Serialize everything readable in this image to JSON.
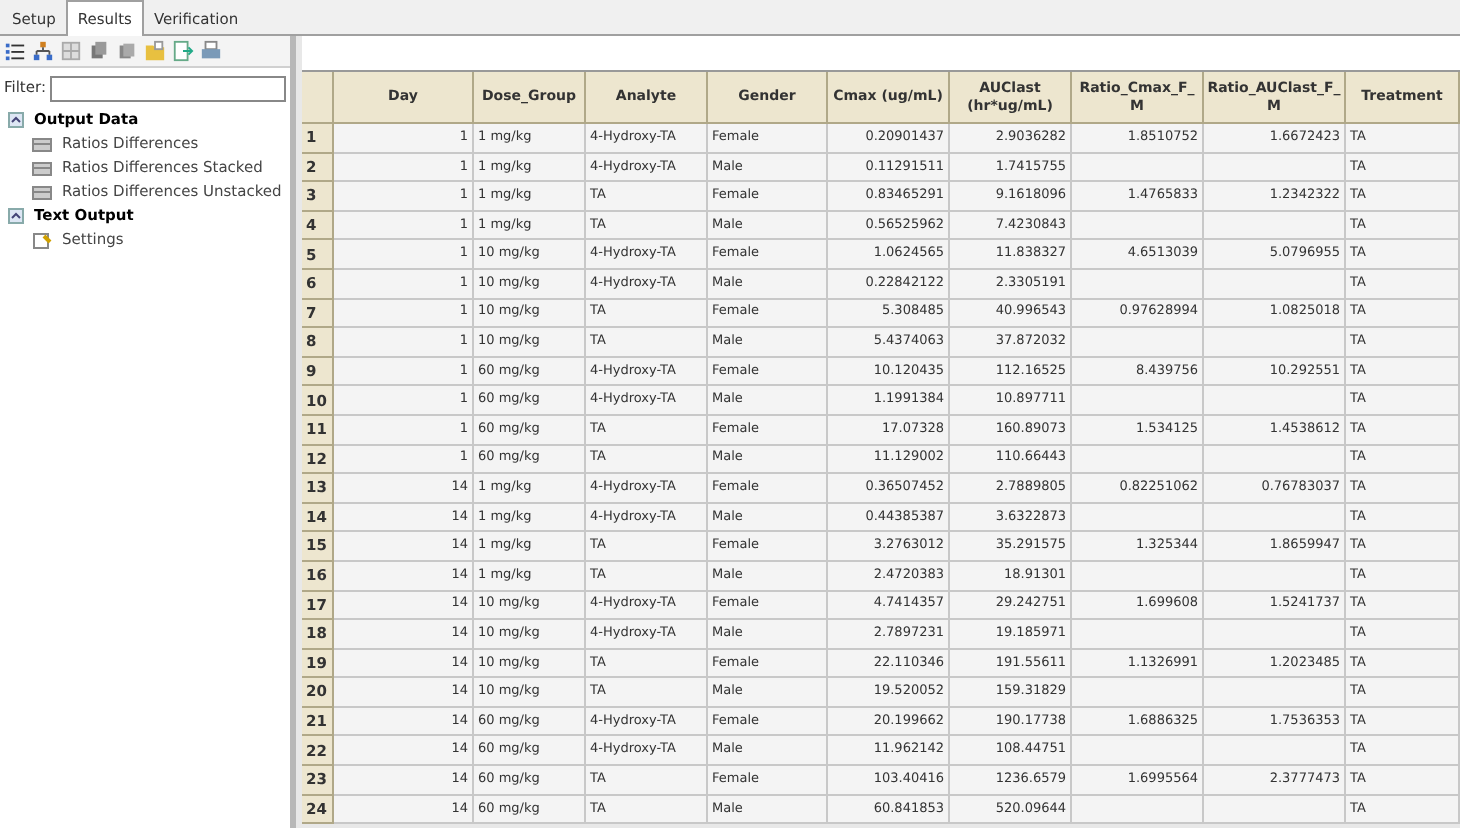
{
  "tabs": [
    {
      "label": "Setup",
      "selected": false
    },
    {
      "label": "Results",
      "selected": true
    },
    {
      "label": "Verification",
      "selected": false
    }
  ],
  "filter": {
    "label": "Filter:"
  },
  "tree": [
    {
      "label": "Output Data",
      "expanded": true,
      "kind": "folder",
      "children": [
        {
          "label": "Ratios Differences",
          "kind": "table",
          "selected": false
        },
        {
          "label": "Ratios Differences Stacked",
          "kind": "table",
          "selected": false
        },
        {
          "label": "Ratios Differences Unstacked",
          "kind": "table",
          "selected": false
        }
      ]
    },
    {
      "label": "Text Output",
      "expanded": true,
      "kind": "folder",
      "children": [
        {
          "label": "Settings",
          "kind": "text",
          "selected": false
        }
      ]
    }
  ],
  "table": {
    "columns": [
      "Day",
      "Dose_Group",
      "Analyte",
      "Gender",
      "Cmax (ug/mL)",
      "AUClast (hr*ug/mL)",
      "Ratio_Cmax_F_M",
      "Ratio_AUClast_F_M",
      "Treatment"
    ],
    "rows": [
      {
        "n": "1",
        "day": "1",
        "dose_group": "1 mg/kg",
        "analyte": "4-Hydroxy-TA",
        "gender": "Female",
        "cmax": "0.20901437",
        "auclast": "2.9036282",
        "ratio_cmax": "1.8510752",
        "ratio_auclast": "1.6672423",
        "treatment": "TA"
      },
      {
        "n": "2",
        "day": "1",
        "dose_group": "1 mg/kg",
        "analyte": "4-Hydroxy-TA",
        "gender": "Male",
        "cmax": "0.11291511",
        "auclast": "1.7415755",
        "treatment": "TA"
      },
      {
        "n": "3",
        "day": "1",
        "dose_group": "1 mg/kg",
        "analyte": "TA",
        "gender": "Female",
        "cmax": "0.83465291",
        "auclast": "9.1618096",
        "ratio_cmax": "1.4765833",
        "ratio_auclast": "1.2342322",
        "treatment": "TA"
      },
      {
        "n": "4",
        "day": "1",
        "dose_group": "1 mg/kg",
        "analyte": "TA",
        "gender": "Male",
        "cmax": "0.56525962",
        "auclast": "7.4230843",
        "treatment": "TA"
      },
      {
        "n": "5",
        "day": "1",
        "dose_group": "10 mg/kg",
        "analyte": "4-Hydroxy-TA",
        "gender": "Female",
        "cmax": "1.0624565",
        "auclast": "11.838327",
        "ratio_cmax": "4.6513039",
        "ratio_auclast": "5.0796955",
        "treatment": "TA"
      },
      {
        "n": "6",
        "day": "1",
        "dose_group": "10 mg/kg",
        "analyte": "4-Hydroxy-TA",
        "gender": "Male",
        "cmax": "0.22842122",
        "auclast": "2.3305191",
        "treatment": "TA"
      },
      {
        "n": "7",
        "day": "1",
        "dose_group": "10 mg/kg",
        "analyte": "TA",
        "gender": "Female",
        "cmax": "5.308485",
        "auclast": "40.996543",
        "ratio_cmax": "0.97628994",
        "ratio_auclast": "1.0825018",
        "treatment": "TA"
      },
      {
        "n": "8",
        "day": "1",
        "dose_group": "10 mg/kg",
        "analyte": "TA",
        "gender": "Male",
        "cmax": "5.4374063",
        "auclast": "37.872032",
        "treatment": "TA"
      },
      {
        "n": "9",
        "day": "1",
        "dose_group": "60 mg/kg",
        "analyte": "4-Hydroxy-TA",
        "gender": "Female",
        "cmax": "10.120435",
        "auclast": "112.16525",
        "ratio_cmax": "8.439756",
        "ratio_auclast": "10.292551",
        "treatment": "TA"
      },
      {
        "n": "10",
        "day": "1",
        "dose_group": "60 mg/kg",
        "analyte": "4-Hydroxy-TA",
        "gender": "Male",
        "cmax": "1.1991384",
        "auclast": "10.897711",
        "treatment": "TA"
      },
      {
        "n": "11",
        "day": "1",
        "dose_group": "60 mg/kg",
        "analyte": "TA",
        "gender": "Female",
        "cmax": "17.07328",
        "auclast": "160.89073",
        "ratio_cmax": "1.534125",
        "ratio_auclast": "1.4538612",
        "treatment": "TA"
      },
      {
        "n": "12",
        "day": "1",
        "dose_group": "60 mg/kg",
        "analyte": "TA",
        "gender": "Male",
        "cmax": "11.129002",
        "auclast": "110.66443",
        "treatment": "TA"
      },
      {
        "n": "13",
        "day": "14",
        "dose_group": "1 mg/kg",
        "analyte": "4-Hydroxy-TA",
        "gender": "Female",
        "cmax": "0.36507452",
        "auclast": "2.7889805",
        "ratio_cmax": "0.82251062",
        "ratio_auclast": "0.76783037",
        "treatment": "TA"
      },
      {
        "n": "14",
        "day": "14",
        "dose_group": "1 mg/kg",
        "analyte": "4-Hydroxy-TA",
        "gender": "Male",
        "cmax": "0.44385387",
        "auclast": "3.6322873",
        "treatment": "TA"
      },
      {
        "n": "15",
        "day": "14",
        "dose_group": "1 mg/kg",
        "analyte": "TA",
        "gender": "Female",
        "cmax": "3.2763012",
        "auclast": "35.291575",
        "ratio_cmax": "1.325344",
        "ratio_auclast": "1.8659947",
        "treatment": "TA"
      },
      {
        "n": "16",
        "day": "14",
        "dose_group": "1 mg/kg",
        "analyte": "TA",
        "gender": "Male",
        "cmax": "2.4720383",
        "auclast": "18.91301",
        "treatment": "TA"
      },
      {
        "n": "17",
        "day": "14",
        "dose_group": "10 mg/kg",
        "analyte": "4-Hydroxy-TA",
        "gender": "Female",
        "cmax": "4.7414357",
        "auclast": "29.242751",
        "ratio_cmax": "1.699608",
        "ratio_auclast": "1.5241737",
        "treatment": "TA"
      },
      {
        "n": "18",
        "day": "14",
        "dose_group": "10 mg/kg",
        "analyte": "4-Hydroxy-TA",
        "gender": "Male",
        "cmax": "2.7897231",
        "auclast": "19.185971",
        "treatment": "TA"
      },
      {
        "n": "19",
        "day": "14",
        "dose_group": "10 mg/kg",
        "analyte": "TA",
        "gender": "Female",
        "cmax": "22.110346",
        "auclast": "191.55611",
        "ratio_cmax": "1.1326991",
        "ratio_auclast": "1.2023485",
        "treatment": "TA"
      },
      {
        "n": "20",
        "day": "14",
        "dose_group": "10 mg/kg",
        "analyte": "TA",
        "gender": "Male",
        "cmax": "19.520052",
        "auclast": "159.31829",
        "treatment": "TA"
      },
      {
        "n": "21",
        "day": "14",
        "dose_group": "60 mg/kg",
        "analyte": "4-Hydroxy-TA",
        "gender": "Female",
        "cmax": "20.199662",
        "auclast": "190.17738",
        "ratio_cmax": "1.6886325",
        "ratio_auclast": "1.7536353",
        "treatment": "TA"
      },
      {
        "n": "22",
        "day": "14",
        "dose_group": "60 mg/kg",
        "analyte": "4-Hydroxy-TA",
        "gender": "Male",
        "cmax": "11.962142",
        "auclast": "108.44751",
        "treatment": "TA"
      },
      {
        "n": "23",
        "day": "14",
        "dose_group": "60 mg/kg",
        "analyte": "TA",
        "gender": "Female",
        "cmax": "103.40416",
        "auclast": "1236.6579",
        "ratio_cmax": "1.6995564",
        "ratio_auclast": "2.3777473",
        "treatment": "TA"
      },
      {
        "n": "24",
        "day": "14",
        "dose_group": "60 mg/kg",
        "analyte": "TA",
        "gender": "Male",
        "cmax": "60.841853",
        "auclast": "520.09644",
        "treatment": "TA"
      }
    ]
  }
}
